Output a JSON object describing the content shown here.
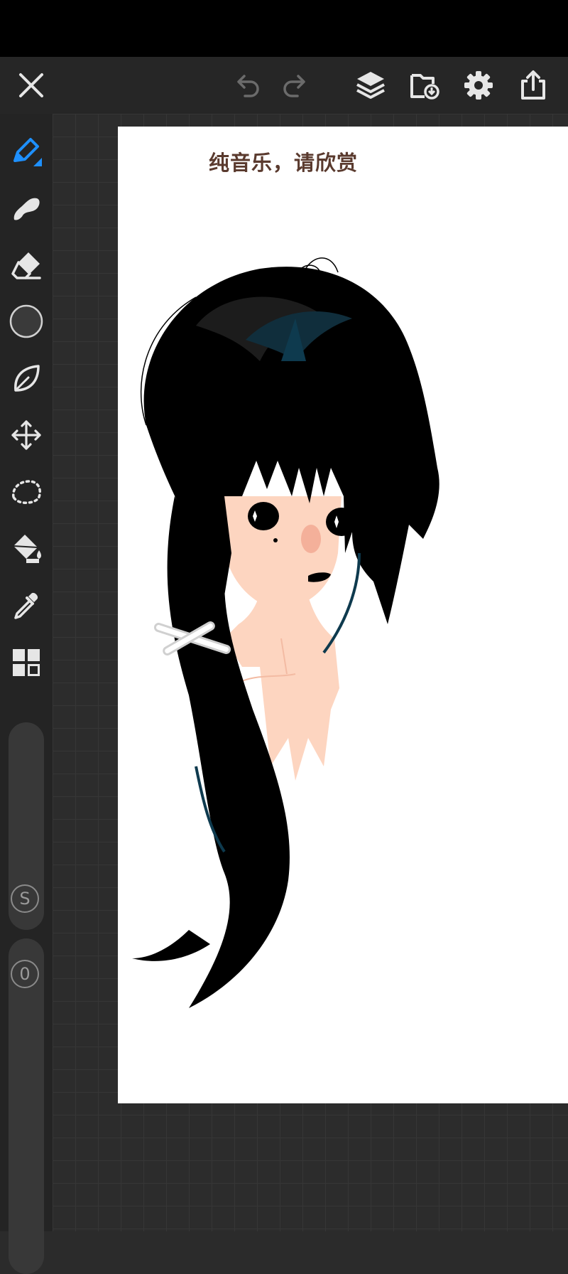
{
  "topbar": {
    "close_icon": "close-icon",
    "undo_icon": "undo-icon",
    "redo_icon": "redo-icon",
    "layers_icon": "layers-icon",
    "gallery_icon": "gallery-import-icon",
    "settings_icon": "gear-icon",
    "share_icon": "share-icon"
  },
  "sidebar": {
    "tools": [
      "brush",
      "smudge",
      "eraser",
      "color",
      "shape",
      "transform",
      "selection",
      "fill",
      "eyedropper",
      "more"
    ],
    "active_tool": "brush",
    "accent_color": "#1e90ff",
    "current_color": "#3a3a3a",
    "size_badge": "S",
    "opacity_badge": "0"
  },
  "canvas": {
    "caption": "纯音乐，请欣赏"
  },
  "colors": {
    "background": "#2b2b2b",
    "toolbar": "#262626",
    "icon": "#e6e6e6",
    "icon_disabled": "#6b6b6b"
  }
}
